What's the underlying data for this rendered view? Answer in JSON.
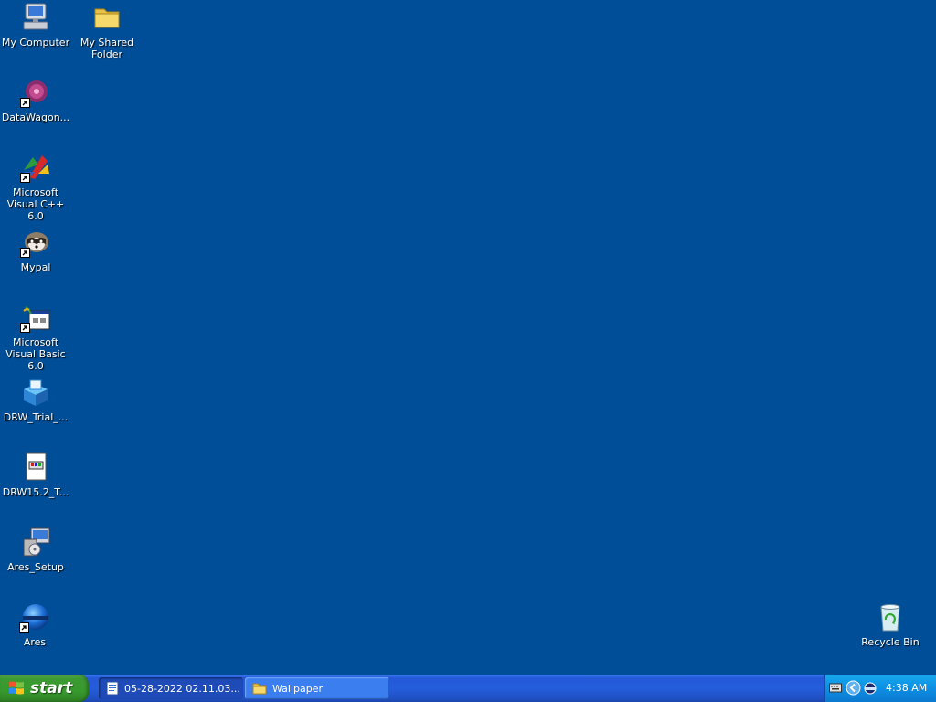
{
  "desktop": {
    "background_color": "#004e98",
    "icons": [
      {
        "label": "My Computer",
        "icon": "my-computer-icon"
      },
      {
        "label": "My Shared Folder",
        "icon": "folder-icon"
      },
      {
        "label": "DataWagon...",
        "icon": "datawagon-icon"
      },
      {
        "label": "Microsoft Visual C++ 6.0",
        "icon": "visual-cpp-icon"
      },
      {
        "label": "Mypal",
        "icon": "mypal-raccoon-icon"
      },
      {
        "label": "Microsoft Visual Basic 6.0",
        "icon": "visual-basic-icon"
      },
      {
        "label": "DRW_Trial_...",
        "icon": "installer-box-icon"
      },
      {
        "label": "DRW15.2_T...",
        "icon": "document-icon"
      },
      {
        "label": "Ares_Setup",
        "icon": "setup-installer-icon"
      },
      {
        "label": "Ares",
        "icon": "ares-globe-icon"
      },
      {
        "label": "Recycle Bin",
        "icon": "recycle-bin-icon"
      }
    ]
  },
  "taskbar": {
    "start_label": "start",
    "tasks": [
      {
        "label": "05-28-2022 02.11.03...",
        "icon": "document-icon",
        "active": true
      },
      {
        "label": "Wallpaper",
        "icon": "folder-icon",
        "active": false
      }
    ],
    "tray": {
      "icons": [
        "keyboard-icon",
        "chevron-left-icon",
        "network-icon"
      ],
      "clock": "4:38 AM"
    }
  }
}
